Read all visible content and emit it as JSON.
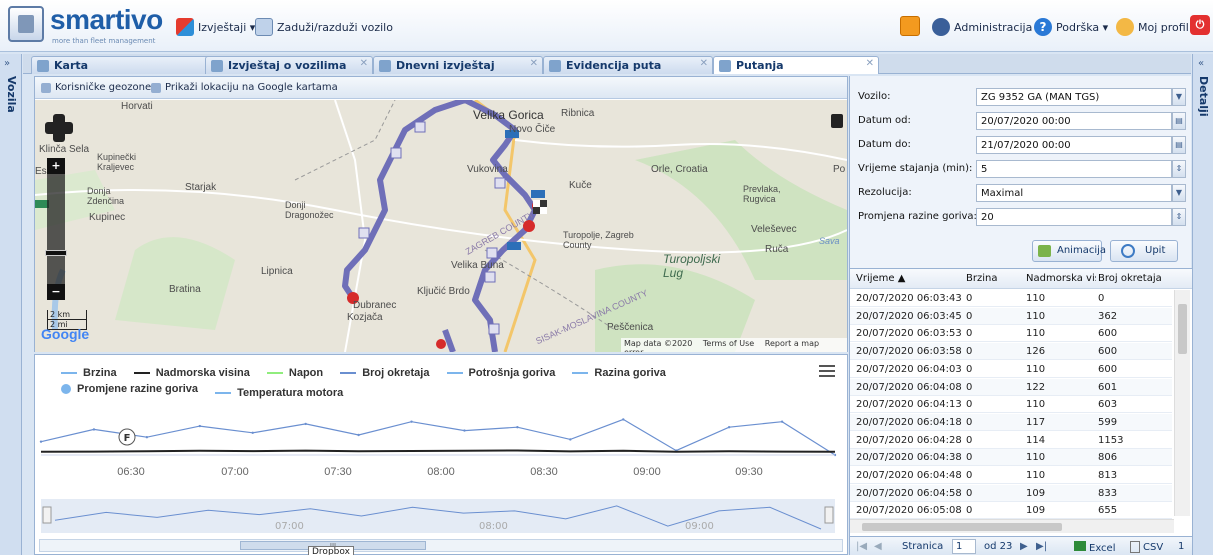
{
  "header": {
    "logo_text": "smartivo",
    "tagline": "more than fleet management",
    "menu_reports": "Izvještaji ▾",
    "menu_charge": "Zaduži/razduži vozilo",
    "menu_admin": "Administracija ▾",
    "menu_support": "Podrška ▾",
    "menu_profile": "Moj profil"
  },
  "left_panel": {
    "title": "Vozila",
    "collapse": "»"
  },
  "right_rail": {
    "title": "Detalji",
    "collapse": "«"
  },
  "tabs": [
    {
      "label": "Karta"
    },
    {
      "label": "Izvještaj o vozilima"
    },
    {
      "label": "Dnevni izvještaj"
    },
    {
      "label": "Evidencija puta"
    },
    {
      "label": "Putanja"
    }
  ],
  "map_toolbar": {
    "geozones": "Korisničke geozone",
    "google": "Prikaži lokaciju na Google kartama"
  },
  "map": {
    "labels": [
      "Horvati",
      "Velika Gorica",
      "Ribnica",
      "Novo Čiče",
      "Klinča Sela",
      "Kupinečki Kraljevec",
      "Starjak",
      "Donja Zdenčina",
      "Kupinec",
      "Donji Dragonožec",
      "Vukovina",
      "Kuče",
      "Orle, Croatia",
      "Prevlaka, Rugvica",
      "Veleševec",
      "Ruča",
      "Turopolje, Zagreb County",
      "Turopoljski Lug",
      "Velika Buna",
      "Lipnica",
      "Bratina",
      "Ključić Brdo",
      "Dubranec",
      "Kozjača",
      "Peščenica",
      "ZAGREB COUNTY",
      "SISAK-MOSLAVINA COUNTY",
      "Esi",
      "Po",
      "Sava"
    ],
    "scale_km": "2 km",
    "scale_mi": "2 mi",
    "google_logo": "Google",
    "credits": [
      "Map data ©2020",
      "Terms of Use",
      "Report a map error"
    ],
    "zoom_in": "+",
    "zoom_out": "−"
  },
  "chart": {
    "legend": [
      {
        "name": "Brzina",
        "color": "#7cb5ec"
      },
      {
        "name": "Nadmorska visina",
        "color": "#222222"
      },
      {
        "name": "Napon",
        "color": "#90ed7d"
      },
      {
        "name": "Broj okretaja",
        "color": "#6a8fd0"
      },
      {
        "name": "Potrošnja goriva",
        "color": "#7cb5ec"
      },
      {
        "name": "Razina goriva",
        "color": "#7cb5ec"
      },
      {
        "name": "Promjene razine goriva",
        "color": "#7cb5ec"
      },
      {
        "name": "Temperatura motora",
        "color": "#7cb5ec"
      }
    ],
    "marker": "F",
    "x_ticks": [
      "06:30",
      "07:00",
      "07:30",
      "08:00",
      "08:30",
      "09:00",
      "09:30"
    ],
    "navigator_ticks": [
      "07:00",
      "08:00",
      "09:00"
    ],
    "scroll_thumb": "III"
  },
  "chart_data": {
    "type": "line",
    "x": [
      "06:03",
      "06:15",
      "06:30",
      "06:45",
      "07:00",
      "07:15",
      "07:30",
      "07:45",
      "08:00",
      "08:15",
      "08:30",
      "08:45",
      "09:00",
      "09:15",
      "09:30",
      "09:45"
    ],
    "series": [
      {
        "name": "Broj okretaja",
        "values": [
          600,
          1150,
          800,
          1300,
          1000,
          1400,
          900,
          1500,
          1100,
          1250,
          700,
          1600,
          200,
          1250,
          1500,
          0
        ]
      },
      {
        "name": "Nadmorska visina",
        "values": [
          110,
          112,
          115,
          118,
          116,
          120,
          114,
          117,
          119,
          121,
          113,
          118,
          110,
          115,
          112,
          110
        ]
      }
    ]
  },
  "form": {
    "vehicle_label": "Vozilo:",
    "vehicle_value": "ZG 9352 GA (MAN TGS)",
    "date_from_label": "Datum od:",
    "date_from_value": "20/07/2020 00:00",
    "date_to_label": "Datum do:",
    "date_to_value": "21/07/2020 00:00",
    "stop_time_label": "Vrijeme stajanja (min):",
    "stop_time_value": "5",
    "resolution_label": "Rezolucija:",
    "resolution_value": "Maximal",
    "fuel_change_label": "Promjena razine goriva:",
    "fuel_change_value": "20",
    "animation_btn": "Animacija",
    "query_btn": "Upit"
  },
  "grid": {
    "columns": [
      "Vrijeme ▲",
      "Brzina",
      "Nadmorska visi",
      "Broj okretaja"
    ],
    "rows": [
      [
        "20/07/2020 06:03:43",
        "0",
        "110",
        "0"
      ],
      [
        "20/07/2020 06:03:45",
        "0",
        "110",
        "362"
      ],
      [
        "20/07/2020 06:03:53",
        "0",
        "110",
        "600"
      ],
      [
        "20/07/2020 06:03:58",
        "0",
        "126",
        "600"
      ],
      [
        "20/07/2020 06:04:03",
        "0",
        "110",
        "600"
      ],
      [
        "20/07/2020 06:04:08",
        "0",
        "122",
        "601"
      ],
      [
        "20/07/2020 06:04:13",
        "0",
        "110",
        "603"
      ],
      [
        "20/07/2020 06:04:18",
        "0",
        "117",
        "599"
      ],
      [
        "20/07/2020 06:04:28",
        "0",
        "114",
        "1153"
      ],
      [
        "20/07/2020 06:04:38",
        "0",
        "110",
        "806"
      ],
      [
        "20/07/2020 06:04:48",
        "0",
        "110",
        "813"
      ],
      [
        "20/07/2020 06:04:58",
        "0",
        "109",
        "833"
      ],
      [
        "20/07/2020 06:05:08",
        "0",
        "109",
        "655"
      ]
    ]
  },
  "pager": {
    "page_label": "Stranica",
    "page_value": "1",
    "of_label": "od 23",
    "excel": "Excel",
    "csv": "CSV",
    "extra": "1"
  },
  "tooltip": "Dropbox"
}
